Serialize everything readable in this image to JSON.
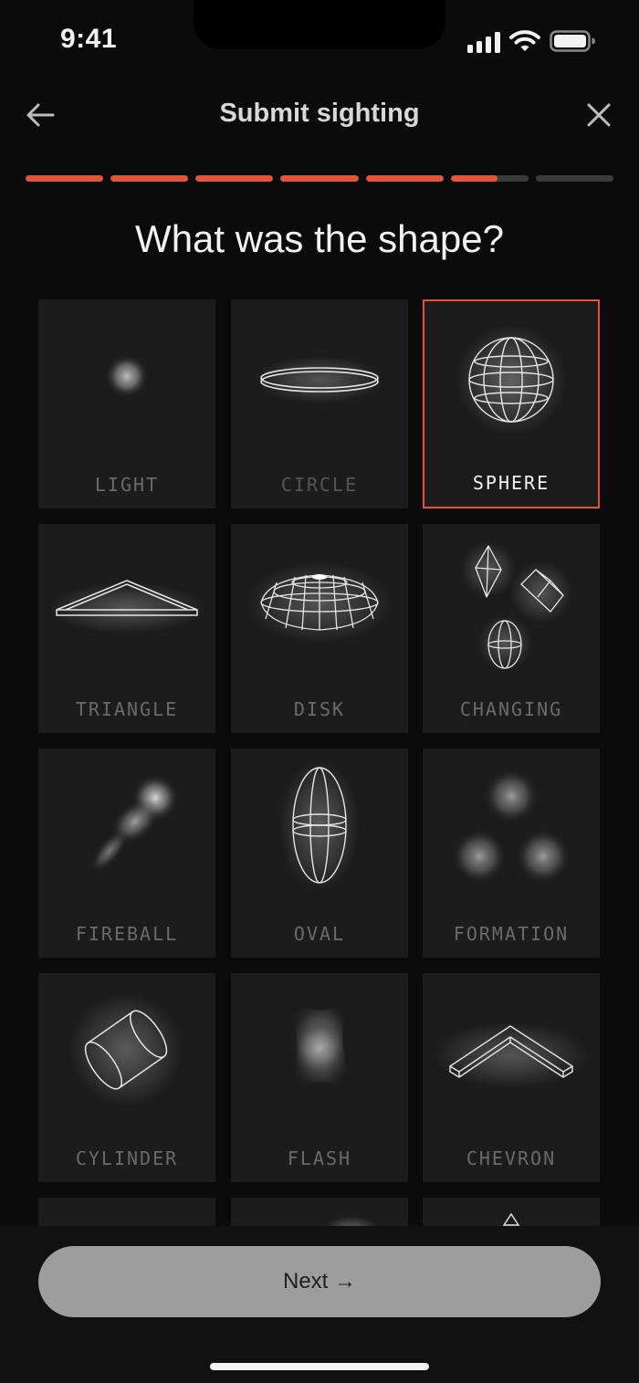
{
  "status_bar": {
    "time": "9:41"
  },
  "header": {
    "title": "Submit sighting"
  },
  "progress": {
    "segments_total": 7,
    "completed": 5.6
  },
  "question": "What was the shape?",
  "accent_color": "#e4533a",
  "shapes": [
    {
      "label": "LIGHT",
      "icon": "light-glow-icon",
      "selected": false
    },
    {
      "label": "CIRCLE",
      "icon": "circle-ring-icon",
      "selected": false
    },
    {
      "label": "SPHERE",
      "icon": "sphere-icon",
      "selected": true
    },
    {
      "label": "TRIANGLE",
      "icon": "triangle-icon",
      "selected": false
    },
    {
      "label": "DISK",
      "icon": "disk-icon",
      "selected": false
    },
    {
      "label": "CHANGING",
      "icon": "changing-shapes-icon",
      "selected": false
    },
    {
      "label": "FIREBALL",
      "icon": "fireball-icon",
      "selected": false
    },
    {
      "label": "OVAL",
      "icon": "oval-icon",
      "selected": false
    },
    {
      "label": "FORMATION",
      "icon": "formation-icon",
      "selected": false
    },
    {
      "label": "CYLINDER",
      "icon": "cylinder-icon",
      "selected": false
    },
    {
      "label": "FLASH",
      "icon": "flash-icon",
      "selected": false
    },
    {
      "label": "CHEVRON",
      "icon": "chevron-shape-icon",
      "selected": false
    }
  ],
  "next_button": {
    "label": "Next →"
  }
}
